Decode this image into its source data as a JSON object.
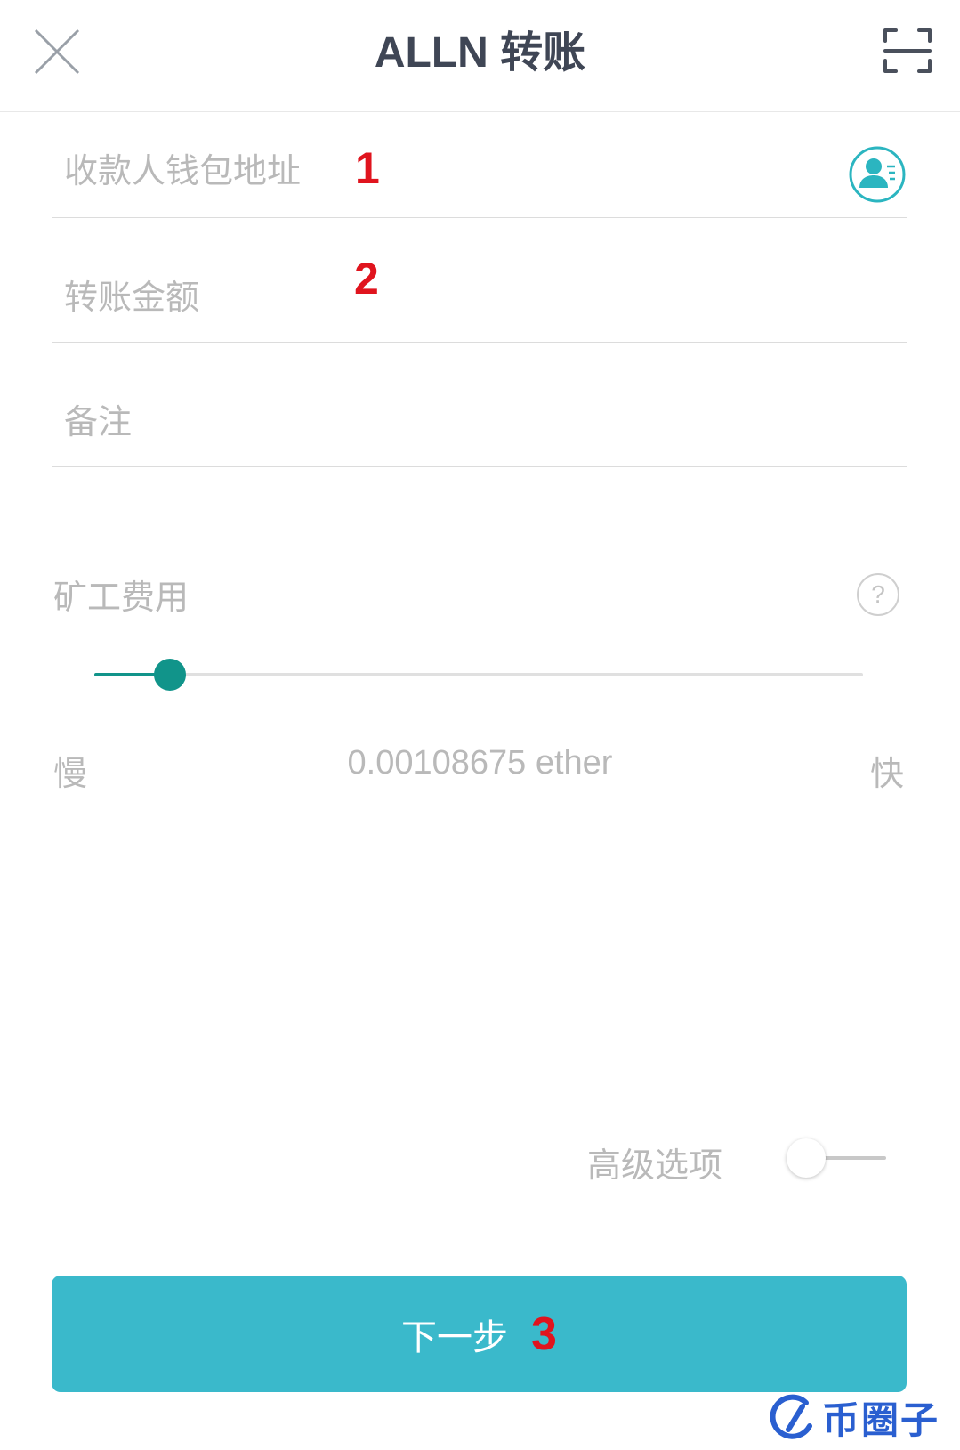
{
  "header": {
    "title": "ALLN 转账",
    "close_icon": "close-icon",
    "scan_icon": "scan-icon"
  },
  "form": {
    "recipient": {
      "placeholder": "收款人钱包地址",
      "value": "",
      "marker": "1",
      "icon": "contact-book-icon"
    },
    "amount": {
      "placeholder": "转账金额",
      "value": "",
      "marker": "2"
    },
    "memo": {
      "placeholder": "备注",
      "value": ""
    }
  },
  "fee": {
    "label": "矿工费用",
    "help_icon": "question-circle-icon",
    "help_glyph": "?",
    "slow_label": "慢",
    "fast_label": "快",
    "value_text": "0.00108675 ether",
    "slider_position": 0.05
  },
  "advanced": {
    "label": "高级选项",
    "enabled": false
  },
  "next_button": {
    "label": "下一步",
    "marker": "3"
  },
  "colors": {
    "accent": "#11948a",
    "button": "#3ab9cb",
    "contact_icon": "#2bb5c0",
    "marker": "#e0141e",
    "placeholder": "#b9b9b9",
    "title": "#3f4655"
  },
  "watermark": {
    "text": "币圈子",
    "icon": "logo-icon"
  }
}
